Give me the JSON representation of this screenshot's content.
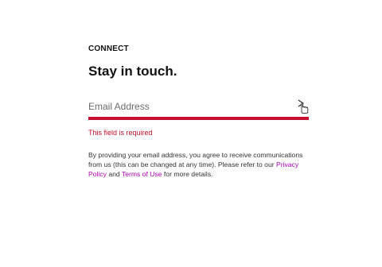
{
  "newsletter": {
    "eyebrow": "CONNECT",
    "headline": "Stay in touch.",
    "email_placeholder": "Email Address",
    "error_text": "This field is required",
    "disclaimer_part1": "By providing your email address, you agree to receive communications from us (this can be changed at any time). Please refer to our ",
    "privacy_link": "Privacy Policy",
    "disclaimer_part2": " and ",
    "terms_link": "Terms of Use",
    "disclaimer_part3": " for more details.",
    "submit_icon": "chevron-right-icon",
    "cursor_icon": "hand-pointer-icon"
  },
  "colors": {
    "accent": "#c8102e",
    "link": "#b000b5",
    "error": "#c8102e"
  }
}
